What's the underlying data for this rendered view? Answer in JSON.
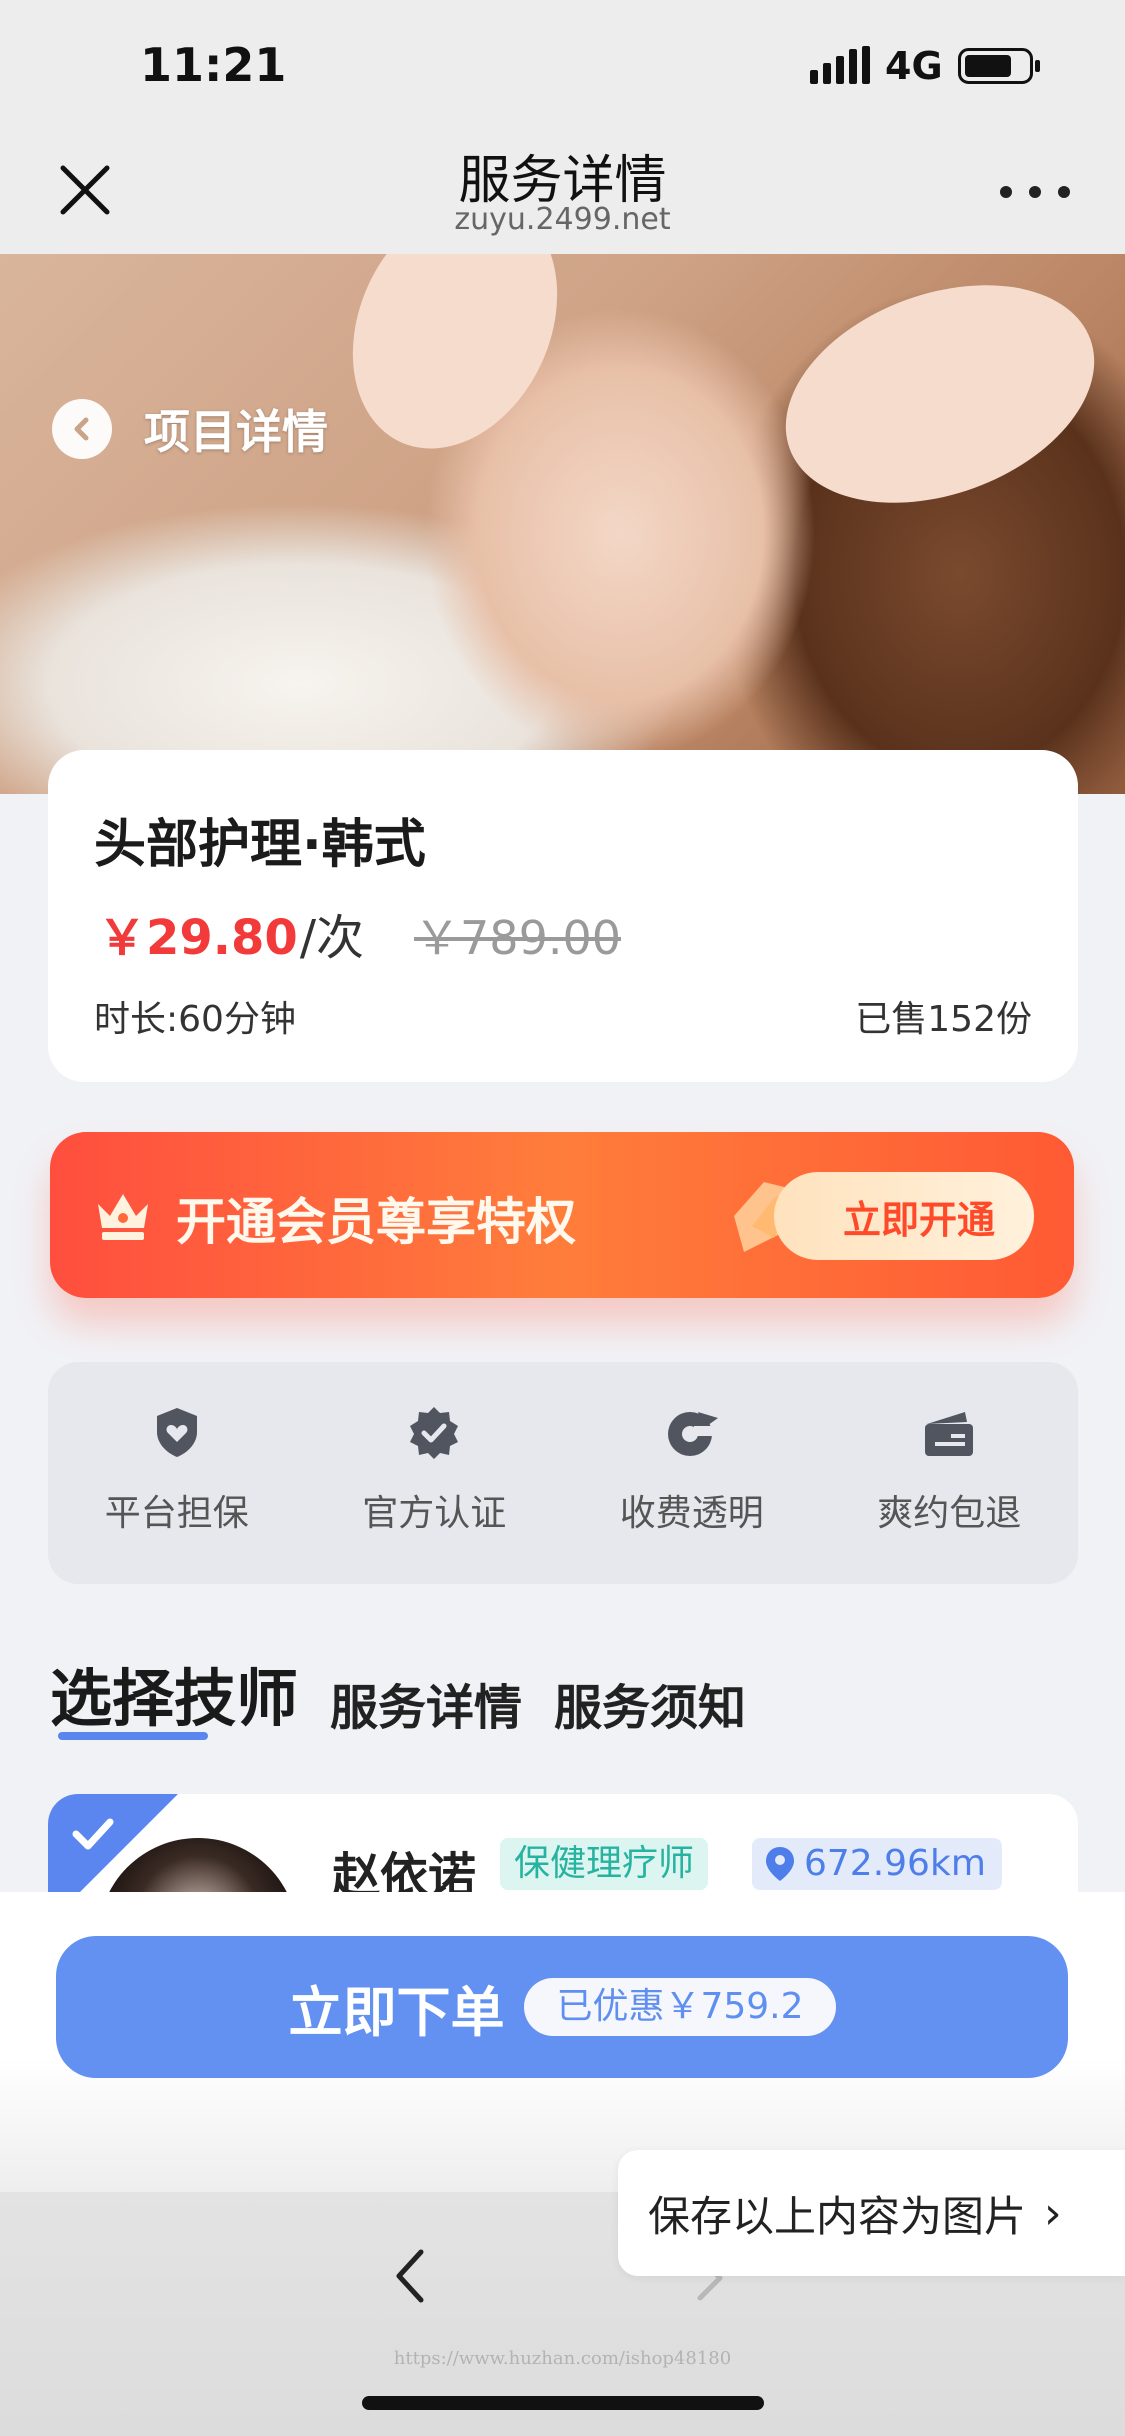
{
  "status_bar": {
    "time": "11:21",
    "network": "4G",
    "icons": [
      "signal-icon",
      "battery-icon"
    ]
  },
  "nav": {
    "title": "服务详情",
    "subtitle": "zuyu.2499.net",
    "icons": [
      "close-icon",
      "more-icon"
    ]
  },
  "hero": {
    "back_label": "项目详情",
    "icon": "chevron-left-icon"
  },
  "product": {
    "name": "头部护理·韩式",
    "price": "￥29.80",
    "price_unit": "/次",
    "original_price": "￥789.00",
    "duration": "时长:60分钟",
    "sold": "已售152份"
  },
  "vip": {
    "text": "开通会员尊享特权",
    "button": "立即开通",
    "icon": "crown-icon"
  },
  "guarantees": [
    {
      "label": "平台担保",
      "icon": "shield-heart-icon"
    },
    {
      "label": "官方认证",
      "icon": "certified-badge-icon"
    },
    {
      "label": "收费透明",
      "icon": "refresh-icon"
    },
    {
      "label": "爽约包退",
      "icon": "wallet-icon"
    }
  ],
  "tabs": [
    {
      "label": "选择技师",
      "active": true
    },
    {
      "label": "服务详情",
      "active": false
    },
    {
      "label": "服务须知",
      "active": false
    }
  ],
  "technician": {
    "name": "赵依诺",
    "role": "保健理疗师",
    "distance": "672.96km"
  },
  "order": {
    "label": "立即下单",
    "discount": "已优惠￥759.2"
  },
  "browser": {
    "watermark": "https://www.huzhan.com/ishop48180"
  },
  "save_image": {
    "label": "保存以上内容为图片",
    "chevron": "›"
  },
  "colors": {
    "accent_blue": "#6391f1",
    "price_red": "#f23a3a",
    "vip_orange": "#ff6a3b",
    "teal": "#26b3a0"
  }
}
